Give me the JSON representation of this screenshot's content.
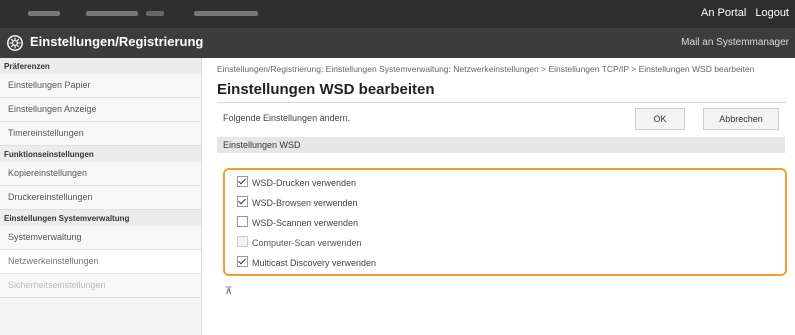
{
  "header": {
    "links": [
      "An Portal",
      "Logout"
    ],
    "title": "Einstellungen/Registrierung",
    "user_mail": "Mail an Systemmanager"
  },
  "sidebar": {
    "groups": [
      {
        "heading": "Präferenzen",
        "items": [
          "Einstellungen Papier",
          "Einstellungen Anzeige",
          "Timereinstellungen"
        ]
      },
      {
        "heading": "Funktionseinstellungen",
        "items": [
          "Kopiereinstellungen",
          "Druckereinstellungen"
        ]
      },
      {
        "heading": "Einstellungen Systemverwaltung",
        "items": [
          "Systemverwaltung",
          "Netzwerkeinstellungen",
          "Sicherheitseinstellungen"
        ]
      }
    ]
  },
  "main": {
    "breadcrumb": "Einstellungen/Registrierung: Einstellungen Systemverwaltung: Netzwerkeinstellungen > Einstellungen TCP/IP > Einstellungen WSD bearbeiten",
    "page_title": "Einstellungen WSD bearbeiten",
    "hint": "Folgende Einstellungen ändern.",
    "ok_label": "OK",
    "cancel_label": "Abbrechen",
    "section_title": "Einstellungen WSD",
    "options": [
      {
        "label": "WSD-Drucken verwenden",
        "checked": true,
        "enabled": true
      },
      {
        "label": "WSD-Browsen verwenden",
        "checked": true,
        "enabled": true
      },
      {
        "label": "WSD-Scannen verwenden",
        "checked": false,
        "enabled": true
      },
      {
        "label": "Computer-Scan verwenden",
        "checked": false,
        "enabled": false
      },
      {
        "label": "Multicast Discovery verwenden",
        "checked": true,
        "enabled": true
      }
    ],
    "to_top_glyph": "⊼"
  },
  "colors": {
    "highlight": "#f0a030",
    "topbar": "#2e2e2e",
    "titlebar": "#3c3c3c"
  }
}
